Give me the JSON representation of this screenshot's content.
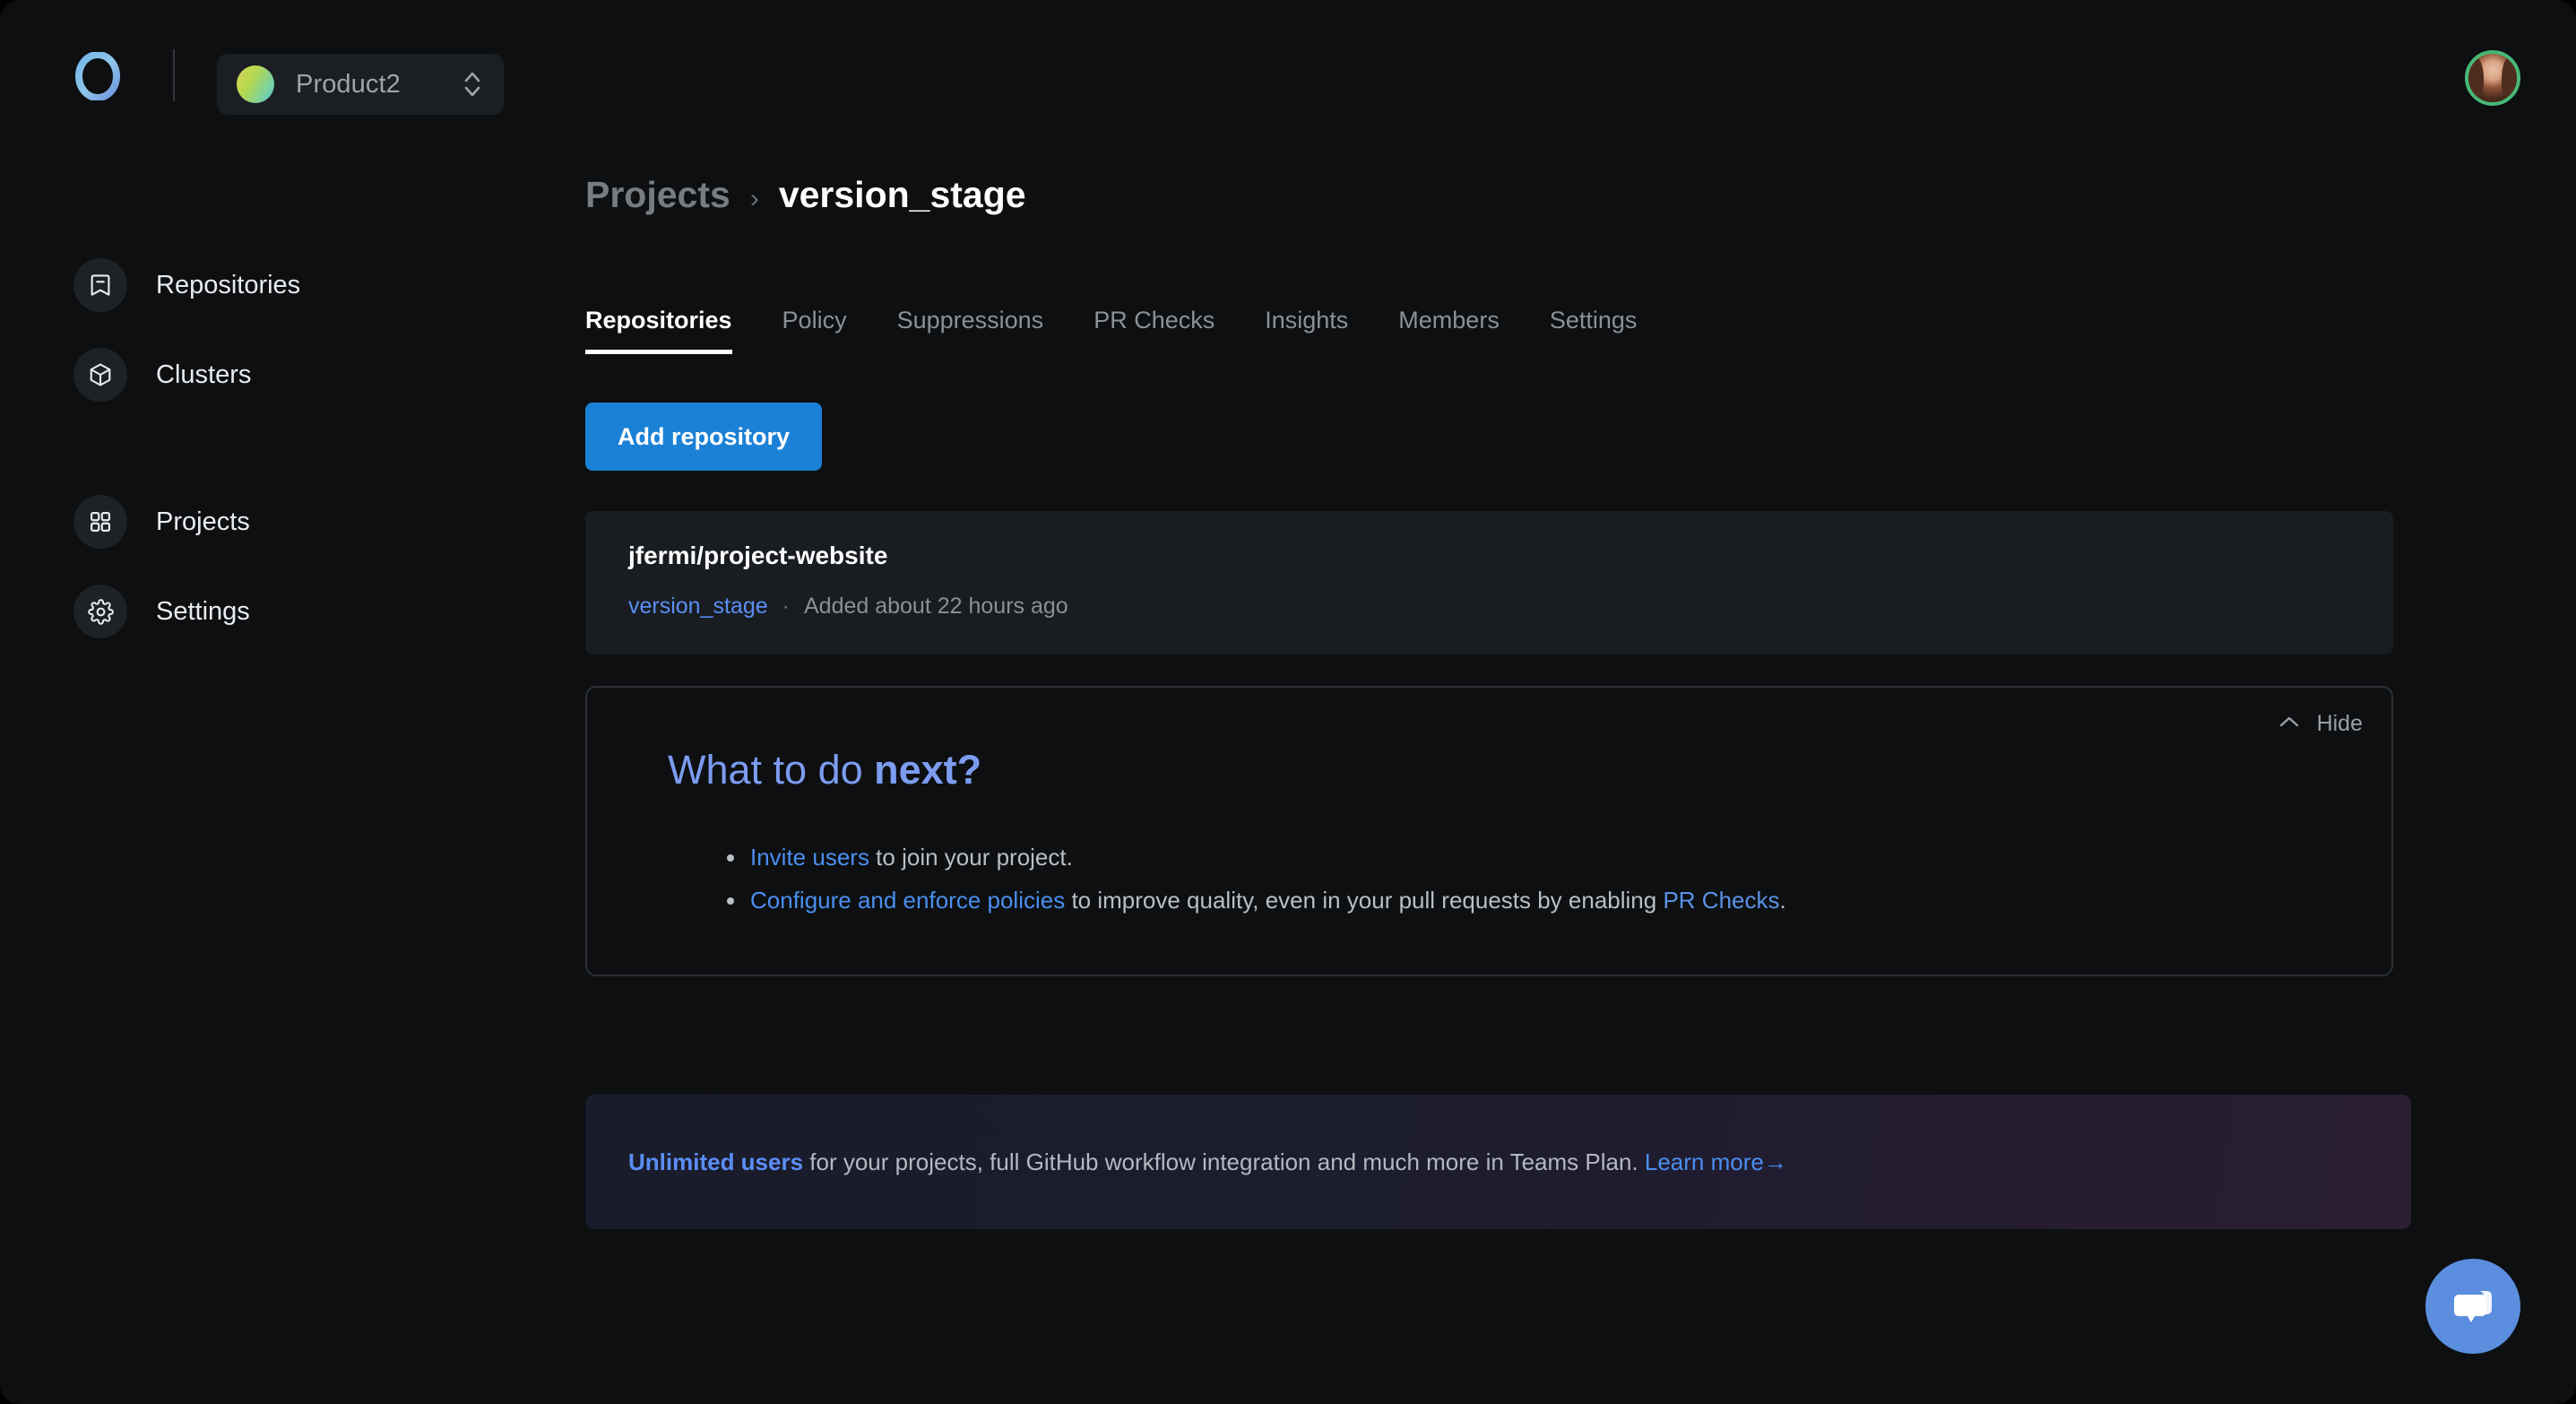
{
  "topbar": {
    "logo_icon": "ring-logo-icon",
    "project_switcher": {
      "name": "Product2",
      "avatar_icon": "project-avatar-gradient",
      "chevron_icon": "chevron-up-down-icon"
    },
    "user_avatar_icon": "user-avatar"
  },
  "sidebar": {
    "items": [
      {
        "label": "Repositories",
        "icon": "bookmark-minus-icon"
      },
      {
        "label": "Clusters",
        "icon": "cube-icon"
      },
      {
        "label": "Projects",
        "icon": "grid-squares-icon"
      },
      {
        "label": "Settings",
        "icon": "gear-icon"
      }
    ]
  },
  "breadcrumb": {
    "parent": "Projects",
    "separator": "›",
    "current": "version_stage"
  },
  "tabs": [
    {
      "label": "Repositories",
      "active": true
    },
    {
      "label": "Policy",
      "active": false
    },
    {
      "label": "Suppressions",
      "active": false
    },
    {
      "label": "PR Checks",
      "active": false
    },
    {
      "label": "Insights",
      "active": false
    },
    {
      "label": "Members",
      "active": false
    },
    {
      "label": "Settings",
      "active": false
    }
  ],
  "actions": {
    "add_repository": "Add repository"
  },
  "repository": {
    "name": "jfermi/project-website",
    "branch": "version_stage",
    "separator": "·",
    "added": "Added about 22 hours ago"
  },
  "next_steps": {
    "hide_label": "Hide",
    "hide_icon": "chevron-up-icon",
    "title_normal": "What to do ",
    "title_bold": "next?",
    "items": [
      {
        "link": "Invite users",
        "rest": " to join your project."
      },
      {
        "link": "Configure and enforce policies",
        "rest": " to improve quality, even in your pull requests by enabling ",
        "link2": "PR Checks",
        "tail": "."
      }
    ]
  },
  "promo": {
    "strong": "Unlimited users",
    "text": " for your projects, full GitHub workflow integration and much more in Teams Plan. ",
    "link": "Learn more",
    "arrow": "→"
  },
  "chat": {
    "icon": "chat-bubble-icon"
  },
  "colors": {
    "page_bg": "#0d0f11",
    "card_bg": "#191d21",
    "accent_blue": "#1b81d6",
    "link_blue": "#4a8ff0",
    "chat_blue": "#5b8ede",
    "avatar_ring": "#47b877",
    "panel_border": "#2c3034"
  }
}
